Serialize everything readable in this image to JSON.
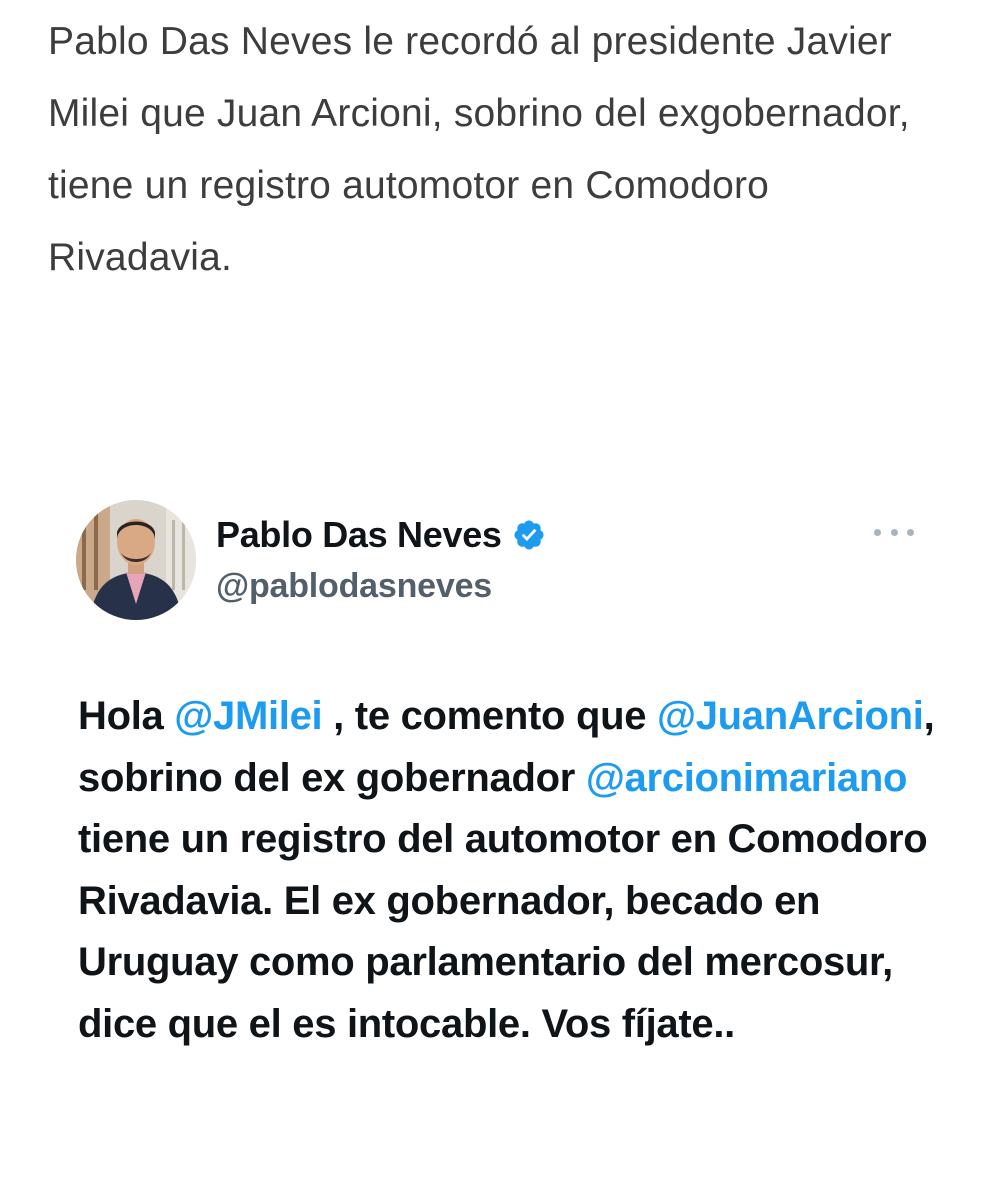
{
  "article": {
    "lede": "Pablo Das Neves le recordó al presidente Javier Milei que Juan Arcioni, sobrino del exgobernador,  tiene un registro automotor en Comodoro Rivadavia."
  },
  "tweet": {
    "display_name": "Pablo Das Neves",
    "handle": "@pablodasneves",
    "verified": true,
    "verified_icon": "verified-badge-icon",
    "more_icon": "more-options-icon",
    "body": {
      "t1": "Hola ",
      "m1": "@JMilei",
      "t2": " , te comento que ",
      "m2": "@JuanArcioni",
      "t3": ", sobrino del ex gobernador ",
      "m3": "@arcionimariano",
      "t4": " tiene un registro del automotor en Comodoro Rivadavia. El ex gobernador, becado en Uruguay como parlamentario del mercosur, dice que el es intocable. Vos fíjate.."
    }
  },
  "colors": {
    "mention": "#1d9bf0",
    "verified": "#1d9bf0",
    "text": "#0f1419",
    "handle": "#53606b"
  }
}
